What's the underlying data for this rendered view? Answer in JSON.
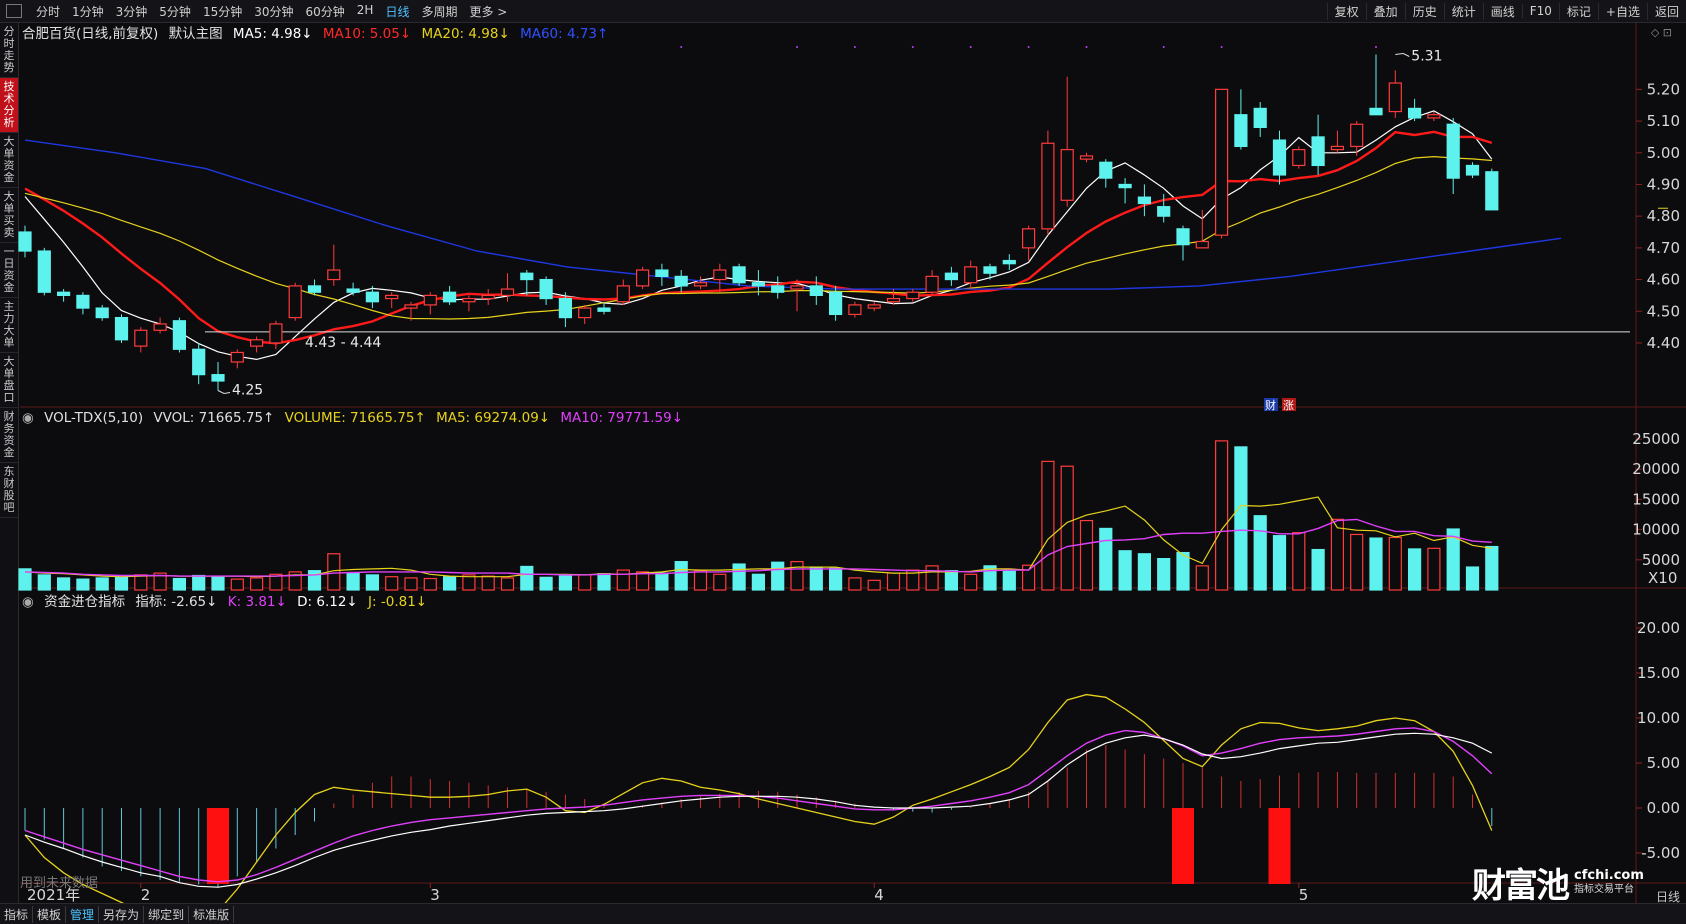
{
  "toolbar": {
    "timeframes": [
      "分时",
      "1分钟",
      "3分钟",
      "5分钟",
      "15分钟",
      "30分钟",
      "60分钟",
      "2H",
      "日线",
      "多周期",
      "更多 >"
    ],
    "active": "日线",
    "right_tools": [
      "复权",
      "叠加",
      "历史",
      "统计",
      "画线",
      "F10",
      "标记",
      "+自选",
      "返回"
    ]
  },
  "sidebar": [
    {
      "label": "分时走势",
      "active": false
    },
    {
      "label": "技术分析",
      "active": true
    },
    {
      "label": "大单资金",
      "active": false
    },
    {
      "label": "大单买卖",
      "active": false
    },
    {
      "label": "一日资金",
      "active": false
    },
    {
      "label": "主力大单",
      "active": false
    },
    {
      "label": "大单盘口",
      "active": false
    },
    {
      "label": "财务资金",
      "active": false
    },
    {
      "label": "东财股吧",
      "active": false
    }
  ],
  "main_legend": {
    "stock": "合肥百货(日线,前复权)",
    "template": "默认主图",
    "ma5": "MA5: 4.98↓",
    "ma10": "MA10: 5.05↓",
    "ma20": "MA20: 4.98↓",
    "ma60": "MA60: 4.73↑"
  },
  "vol_legend": {
    "name": "VOL-TDX(5,10)",
    "vvol": "VVOL: 71665.75↑",
    "volume": "VOLUME: 71665.75↑",
    "ma5": "MA5: 69274.09↓",
    "ma10": "MA10: 79771.59↓"
  },
  "ind_legend": {
    "name": "资金进仓指标",
    "idx": "指标: -2.65↓",
    "k": "K: 3.81↓",
    "d": "D: 6.12↓",
    "j": "J: -0.81↓"
  },
  "annotations": {
    "high": "5.31",
    "low": "4.25",
    "range": "4.43 - 4.44",
    "badge1": "财",
    "badge2": "涨"
  },
  "x_labels": [
    "2021年",
    "2",
    "3",
    "4",
    "5"
  ],
  "bottom_tabs": [
    "指标",
    "模板",
    "管理",
    "另存为",
    "绑定到",
    "标准版"
  ],
  "bottom_active": "管理",
  "corner": "日线",
  "vol_unit": "X10",
  "future_text": "用到未来数据",
  "logo": {
    "main": "财富池",
    "domain": "cfchi.com",
    "sub": "指标交易平台"
  },
  "colors": {
    "up": "#ff3b3b",
    "down": "#5ef2ee",
    "ma5": "#ffffff",
    "ma10": "#ff1a1a",
    "ma20": "#e6d21c",
    "ma60": "#1f37e0",
    "k": "#ffffff",
    "d": "#e040fb",
    "j": "#e6d21c",
    "bg": "#0c0c0e"
  },
  "chart_data": [
    {
      "type": "candlestick",
      "title": "合肥百货(日线,前复权)",
      "ylim": [
        4.22,
        5.34
      ],
      "yticks": [
        4.4,
        4.5,
        4.6,
        4.7,
        4.8,
        4.9,
        5.0,
        5.1,
        5.2
      ],
      "ohlc": [
        [
          4.75,
          4.77,
          4.67,
          4.69
        ],
        [
          4.69,
          4.7,
          4.55,
          4.56
        ],
        [
          4.56,
          4.57,
          4.53,
          4.55
        ],
        [
          4.55,
          4.56,
          4.49,
          4.51
        ],
        [
          4.51,
          4.52,
          4.47,
          4.48
        ],
        [
          4.48,
          4.49,
          4.4,
          4.41
        ],
        [
          4.39,
          4.45,
          4.37,
          4.44
        ],
        [
          4.44,
          4.48,
          4.43,
          4.46
        ],
        [
          4.47,
          4.48,
          4.37,
          4.38
        ],
        [
          4.38,
          4.4,
          4.27,
          4.3
        ],
        [
          4.3,
          4.34,
          4.25,
          4.28
        ],
        [
          4.34,
          4.38,
          4.32,
          4.37
        ],
        [
          4.39,
          4.42,
          4.37,
          4.41
        ],
        [
          4.4,
          4.47,
          4.38,
          4.46
        ],
        [
          4.48,
          4.59,
          4.47,
          4.58
        ],
        [
          4.58,
          4.6,
          4.55,
          4.56
        ],
        [
          4.6,
          4.71,
          4.58,
          4.63
        ],
        [
          4.57,
          4.59,
          4.55,
          4.56
        ],
        [
          4.56,
          4.58,
          4.51,
          4.53
        ],
        [
          4.54,
          4.56,
          4.51,
          4.55
        ],
        [
          4.51,
          4.53,
          4.47,
          4.52
        ],
        [
          4.52,
          4.56,
          4.49,
          4.55
        ],
        [
          4.56,
          4.58,
          4.52,
          4.53
        ],
        [
          4.53,
          4.55,
          4.5,
          4.54
        ],
        [
          4.54,
          4.57,
          4.52,
          4.55
        ],
        [
          4.55,
          4.62,
          4.53,
          4.57
        ],
        [
          4.62,
          4.63,
          4.55,
          4.6
        ],
        [
          4.6,
          4.61,
          4.52,
          4.54
        ],
        [
          4.54,
          4.56,
          4.45,
          4.48
        ],
        [
          4.48,
          4.52,
          4.46,
          4.51
        ],
        [
          4.51,
          4.53,
          4.49,
          4.5
        ],
        [
          4.53,
          4.6,
          4.52,
          4.58
        ],
        [
          4.58,
          4.64,
          4.57,
          4.63
        ],
        [
          4.63,
          4.65,
          4.58,
          4.61
        ],
        [
          4.61,
          4.63,
          4.56,
          4.58
        ],
        [
          4.58,
          4.61,
          4.57,
          4.59
        ],
        [
          4.6,
          4.65,
          4.56,
          4.63
        ],
        [
          4.64,
          4.65,
          4.58,
          4.59
        ],
        [
          4.59,
          4.63,
          4.55,
          4.58
        ],
        [
          4.58,
          4.61,
          4.54,
          4.56
        ],
        [
          4.57,
          4.6,
          4.5,
          4.58
        ],
        [
          4.58,
          4.61,
          4.52,
          4.55
        ],
        [
          4.56,
          4.58,
          4.47,
          4.49
        ],
        [
          4.49,
          4.53,
          4.48,
          4.52
        ],
        [
          4.51,
          4.53,
          4.5,
          4.52
        ],
        [
          4.53,
          4.57,
          4.52,
          4.54
        ],
        [
          4.54,
          4.57,
          4.53,
          4.56
        ],
        [
          4.56,
          4.63,
          4.55,
          4.61
        ],
        [
          4.62,
          4.64,
          4.58,
          4.6
        ],
        [
          4.59,
          4.66,
          4.57,
          4.64
        ],
        [
          4.64,
          4.65,
          4.6,
          4.62
        ],
        [
          4.66,
          4.68,
          4.63,
          4.65
        ],
        [
          4.7,
          4.77,
          4.66,
          4.76
        ],
        [
          4.76,
          5.07,
          4.74,
          5.03
        ],
        [
          4.85,
          5.24,
          4.83,
          5.01
        ],
        [
          4.98,
          5.0,
          4.97,
          4.99
        ],
        [
          4.97,
          4.98,
          4.89,
          4.92
        ],
        [
          4.9,
          4.92,
          4.84,
          4.89
        ],
        [
          4.86,
          4.9,
          4.8,
          4.84
        ],
        [
          4.83,
          4.87,
          4.78,
          4.8
        ],
        [
          4.76,
          4.77,
          4.66,
          4.71
        ],
        [
          4.7,
          4.82,
          4.7,
          4.72
        ],
        [
          4.74,
          5.2,
          4.73,
          5.2
        ],
        [
          5.12,
          5.2,
          5.01,
          5.02
        ],
        [
          5.14,
          5.16,
          5.05,
          5.08
        ],
        [
          5.04,
          5.07,
          4.9,
          4.93
        ],
        [
          4.96,
          5.02,
          4.95,
          5.01
        ],
        [
          5.05,
          5.12,
          4.93,
          4.96
        ],
        [
          5.01,
          5.07,
          5.0,
          5.02
        ],
        [
          5.02,
          5.1,
          4.99,
          5.09
        ],
        [
          5.14,
          5.31,
          5.12,
          5.12
        ],
        [
          5.13,
          5.26,
          5.11,
          5.22
        ],
        [
          5.14,
          5.17,
          5.1,
          5.11
        ],
        [
          5.11,
          5.13,
          5.1,
          5.12
        ],
        [
          5.09,
          5.11,
          4.87,
          4.92
        ],
        [
          4.96,
          4.97,
          4.92,
          4.93
        ],
        [
          4.94,
          4.95,
          4.82,
          4.82
        ]
      ],
      "ma60": [
        [
          0,
          5.04
        ],
        [
          10,
          5.0
        ],
        [
          20,
          4.95
        ],
        [
          30,
          4.86
        ],
        [
          40,
          4.77
        ],
        [
          50,
          4.69
        ],
        [
          60,
          4.64
        ],
        [
          70,
          4.61
        ],
        [
          80,
          4.58
        ],
        [
          90,
          4.57
        ],
        [
          100,
          4.57
        ],
        [
          110,
          4.57
        ],
        [
          120,
          4.57
        ],
        [
          130,
          4.58
        ],
        [
          140,
          4.61
        ],
        [
          150,
          4.65
        ],
        [
          160,
          4.69
        ],
        [
          170,
          4.73
        ]
      ],
      "ma_window": [
        5,
        10,
        20
      ],
      "ma_seed": [
        4.86,
        4.85,
        4.84,
        4.83,
        4.84,
        4.85,
        4.86,
        4.87,
        4.88,
        4.89,
        4.9,
        4.91,
        4.91,
        4.92,
        4.92,
        4.92,
        4.91,
        4.9,
        4.89
      ]
    },
    {
      "type": "bar",
      "title": "VOL-TDX(5,10)",
      "ylim": [
        0,
        26500
      ],
      "yticks": [
        5000,
        10000,
        15000,
        20000,
        25000
      ],
      "values": [
        3500,
        2500,
        2000,
        1800,
        2000,
        2100,
        2500,
        2800,
        1900,
        2400,
        2200,
        1800,
        2000,
        2600,
        3000,
        3200,
        6000,
        2800,
        2500,
        2200,
        2000,
        1900,
        2200,
        2500,
        2300,
        2000,
        3900,
        2100,
        2300,
        2500,
        2700,
        3300,
        3000,
        2800,
        4700,
        3200,
        2600,
        4300,
        2600,
        4600,
        4700,
        3800,
        3600,
        2000,
        1600,
        2800,
        3300,
        4000,
        3200,
        2600,
        4000,
        3100,
        4100,
        21300,
        20500,
        11500,
        10200,
        6500,
        6000,
        5200,
        6200,
        4000,
        24700,
        23700,
        12300,
        9000,
        9500,
        6700,
        11700,
        9200,
        8600,
        8700,
        6800,
        6900,
        10100,
        3800,
        7200
      ],
      "ma5": [
        3000,
        2800,
        2700,
        2500,
        2300,
        2200,
        2300,
        2400,
        2300,
        2300,
        2300,
        2300,
        2200,
        2300,
        2500,
        2500,
        3200,
        3400,
        3500,
        3600,
        3300,
        2600,
        2300,
        2200,
        2200,
        2200,
        2600,
        2600,
        2600,
        2500,
        2700,
        2600,
        2800,
        3000,
        3400,
        3300,
        3300,
        3400,
        3500,
        3500,
        3800,
        3800,
        3800,
        3300,
        3000,
        2800,
        2800,
        3000,
        3000,
        3100,
        3500,
        3500,
        3300,
        8400,
        11200,
        12400,
        13100,
        13900,
        11600,
        8300,
        5800,
        4400,
        10000,
        14000,
        13900,
        14200,
        14800,
        15400,
        10300,
        9900,
        9800,
        8800,
        9400,
        8200,
        8800,
        7400,
        6900
      ],
      "ma10": [
        3000,
        2900,
        2800,
        2600,
        2500,
        2400,
        2400,
        2400,
        2300,
        2300,
        2300,
        2300,
        2300,
        2300,
        2400,
        2500,
        2800,
        2900,
        3000,
        3000,
        3000,
        3000,
        2900,
        2800,
        2800,
        2800,
        2600,
        2600,
        2500,
        2500,
        2600,
        2600,
        2700,
        2700,
        2900,
        3000,
        3000,
        3100,
        3200,
        3400,
        3500,
        3500,
        3500,
        3500,
        3400,
        3300,
        3200,
        3200,
        3100,
        3000,
        3200,
        3300,
        3300,
        5800,
        7200,
        7700,
        8200,
        8300,
        8500,
        9200,
        9400,
        9400,
        9700,
        9900,
        9800,
        9300,
        9300,
        10200,
        11500,
        11700,
        10600,
        9700,
        9700,
        9000,
        8900,
        8100,
        7900
      ]
    },
    {
      "type": "indicator",
      "title": "资金进仓指标",
      "ylim": [
        -8,
        22
      ],
      "yticks": [
        -5,
        0,
        5,
        10,
        15,
        20
      ],
      "k": [
        -3.0,
        -3.8,
        -4.5,
        -5.3,
        -6.0,
        -6.6,
        -7.2,
        -7.6,
        -8.3,
        -8.7,
        -8.8,
        -8.5,
        -7.9,
        -7.2,
        -6.4,
        -5.5,
        -4.7,
        -4.1,
        -3.6,
        -3.1,
        -2.7,
        -2.4,
        -2.0,
        -1.7,
        -1.4,
        -1.1,
        -0.8,
        -0.6,
        -0.5,
        -0.4,
        -0.3,
        -0.1,
        0.2,
        0.5,
        0.8,
        1.0,
        1.2,
        1.3,
        1.3,
        1.3,
        1.2,
        1.0,
        0.7,
        0.3,
        0.1,
        0.0,
        0.0,
        0.0,
        0.1,
        0.2,
        0.5,
        0.9,
        1.5,
        3.0,
        4.8,
        6.2,
        7.2,
        7.8,
        8.1,
        7.7,
        7.0,
        6.0,
        5.5,
        5.7,
        6.1,
        6.6,
        6.9,
        7.2,
        7.3,
        7.6,
        7.9,
        8.2,
        8.3,
        8.2,
        7.8,
        7.2,
        6.1
      ],
      "d": [
        -2.5,
        -3.2,
        -3.9,
        -4.6,
        -5.2,
        -5.8,
        -6.4,
        -7.0,
        -7.6,
        -8.0,
        -8.2,
        -8.0,
        -7.4,
        -6.6,
        -5.7,
        -4.8,
        -3.9,
        -3.1,
        -2.5,
        -2.0,
        -1.6,
        -1.3,
        -1.1,
        -0.9,
        -0.7,
        -0.5,
        -0.3,
        -0.1,
        0.0,
        0.1,
        0.3,
        0.6,
        0.9,
        1.1,
        1.3,
        1.4,
        1.4,
        1.4,
        1.3,
        1.1,
        0.8,
        0.5,
        0.2,
        -0.1,
        -0.2,
        -0.2,
        0.0,
        0.2,
        0.5,
        0.8,
        1.2,
        1.7,
        2.6,
        4.2,
        5.8,
        7.2,
        8.1,
        8.6,
        8.4,
        7.7,
        6.9,
        5.8,
        6.1,
        6.6,
        7.2,
        7.6,
        7.8,
        7.9,
        8.0,
        8.2,
        8.5,
        8.8,
        8.9,
        8.5,
        7.4,
        5.8,
        3.8
      ],
      "j": [
        -3.0,
        -5.5,
        -7.2,
        -8.5,
        -9.5,
        -10.5,
        -11.5,
        -12.5,
        -13.3,
        -13.0,
        -11.5,
        -9.0,
        -6.0,
        -3.0,
        -0.5,
        1.5,
        2.3,
        2.0,
        1.8,
        1.6,
        1.4,
        1.2,
        1.2,
        1.3,
        1.5,
        1.9,
        2.1,
        1.2,
        -0.3,
        -0.5,
        0.4,
        1.6,
        2.8,
        3.3,
        3.0,
        2.3,
        2.0,
        1.6,
        1.0,
        0.5,
        0.0,
        -0.5,
        -1.0,
        -1.5,
        -1.8,
        -1.0,
        0.3,
        1.0,
        1.8,
        2.6,
        3.5,
        4.5,
        6.5,
        9.5,
        12.0,
        12.6,
        12.3,
        11.0,
        9.5,
        7.5,
        5.5,
        4.6,
        7.0,
        8.8,
        9.5,
        9.4,
        8.9,
        8.6,
        8.8,
        9.1,
        9.7,
        10.0,
        9.7,
        8.5,
        6.3,
        2.5,
        -2.5
      ],
      "hist": [
        -2.5,
        -3.5,
        -4.5,
        -5.5,
        -6.5,
        -7.0,
        -7.6,
        -8.0,
        -8.2,
        -8.5,
        -8.8,
        -7.6,
        -6.0,
        -4.5,
        -3.0,
        -1.5,
        0.5,
        1.5,
        2.8,
        3.5,
        3.5,
        3.2,
        3.0,
        2.8,
        2.5,
        2.3,
        2.0,
        1.8,
        1.5,
        1.0,
        0.5,
        0.0,
        0.3,
        0.6,
        1.0,
        1.3,
        1.6,
        1.8,
        1.9,
        1.8,
        1.5,
        1.2,
        0.8,
        0.5,
        0.1,
        -0.2,
        -0.4,
        -0.5,
        -0.2,
        0.1,
        0.5,
        1.0,
        1.8,
        3.0,
        4.5,
        6.5,
        7.0,
        6.5,
        6.0,
        5.5,
        5.0,
        4.5,
        3.5,
        3.0,
        3.2,
        3.6,
        3.9,
        4.0,
        4.0,
        3.9,
        3.9,
        3.9,
        3.9,
        3.9,
        3.5,
        1.5,
        -2.0
      ],
      "signals": [
        10,
        60,
        65
      ]
    }
  ]
}
